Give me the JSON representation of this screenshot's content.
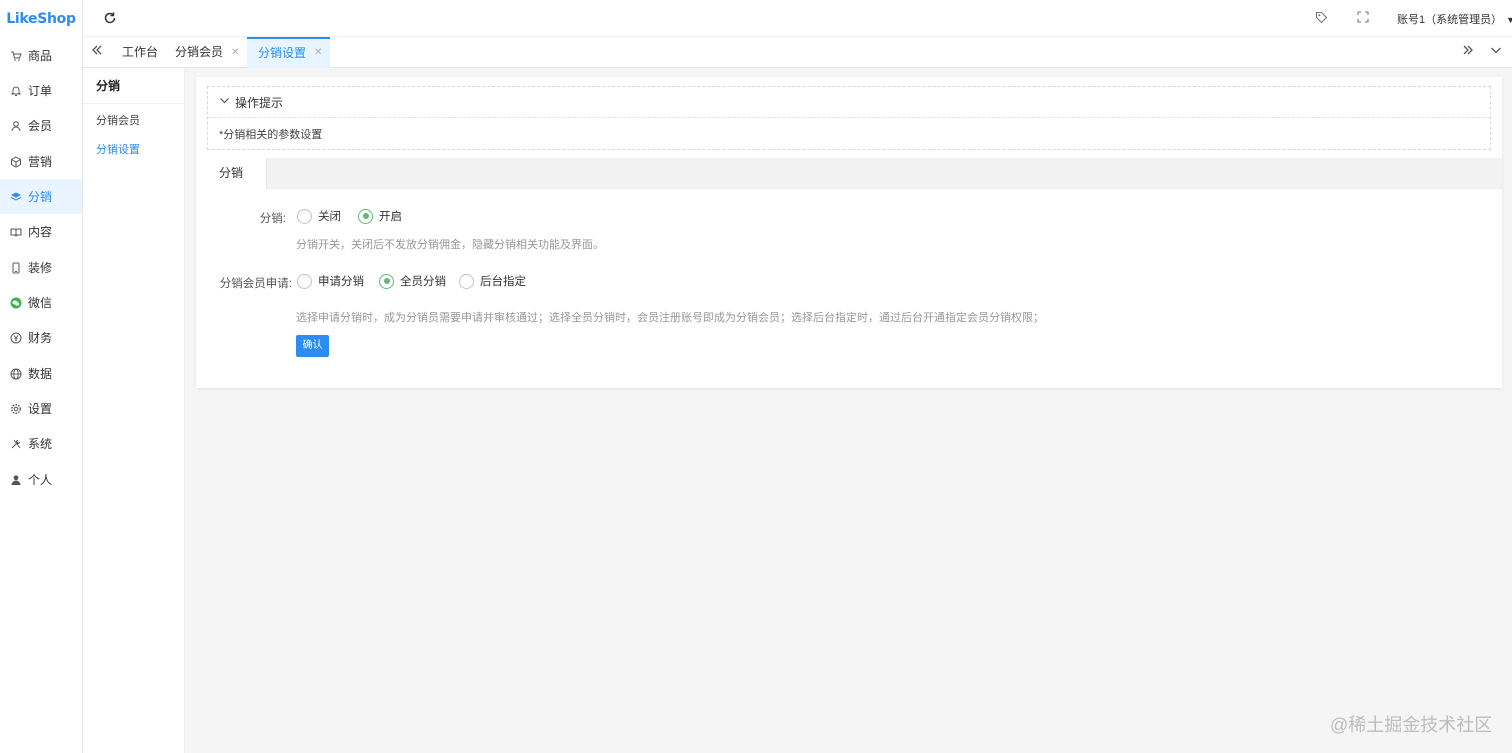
{
  "logo": "LikeShop",
  "colors": {
    "accent": "#2d8cf0",
    "radio_checked": "#5fb878",
    "active_bg": "#e8f4ff"
  },
  "nav": [
    {
      "label": "商品",
      "icon": "cart-icon"
    },
    {
      "label": "订单",
      "icon": "bell-icon"
    },
    {
      "label": "会员",
      "icon": "user-icon"
    },
    {
      "label": "营销",
      "icon": "cube-icon"
    },
    {
      "label": "分销",
      "icon": "layers-icon",
      "active": true
    },
    {
      "label": "内容",
      "icon": "book-icon"
    },
    {
      "label": "装修",
      "icon": "phone-icon"
    },
    {
      "label": "微信",
      "icon": "wechat-icon"
    },
    {
      "label": "财务",
      "icon": "yen-icon"
    },
    {
      "label": "数据",
      "icon": "globe-icon"
    },
    {
      "label": "设置",
      "icon": "gear-icon"
    },
    {
      "label": "系统",
      "icon": "tools-icon"
    },
    {
      "label": "个人",
      "icon": "person-icon"
    }
  ],
  "header": {
    "account": "账号1（系统管理员）",
    "icons": [
      "refresh-icon",
      "tag-icon",
      "fullscreen-icon",
      "caret-down-icon"
    ]
  },
  "tabs": [
    {
      "label": "工作台"
    },
    {
      "label": "分销会员",
      "closable": true
    },
    {
      "label": "分销设置",
      "closable": true,
      "active": true
    }
  ],
  "subnav": {
    "title": "分销",
    "items": [
      {
        "label": "分销会员"
      },
      {
        "label": "分销设置",
        "active": true
      }
    ]
  },
  "tips": {
    "title": "操作提示",
    "body": "*分销相关的参数设置"
  },
  "content_tab": "分销",
  "form": {
    "field1": {
      "label": "分销:",
      "options": [
        {
          "label": "关闭",
          "checked": false
        },
        {
          "label": "开启",
          "checked": true
        }
      ],
      "hint": "分销开关，关闭后不发放分销佣金，隐藏分销相关功能及界面。"
    },
    "field2": {
      "label": "分销会员申请:",
      "options": [
        {
          "label": "申请分销",
          "checked": false
        },
        {
          "label": "全员分销",
          "checked": true
        },
        {
          "label": "后台指定",
          "checked": false
        }
      ],
      "hint": "选择申请分销时，成为分销员需要申请并审核通过；选择全员分销时，会员注册账号即成为分销会员；选择后台指定时，通过后台开通指定会员分销权限；"
    },
    "confirm": "确认"
  },
  "watermark": "@稀土掘金技术社区"
}
